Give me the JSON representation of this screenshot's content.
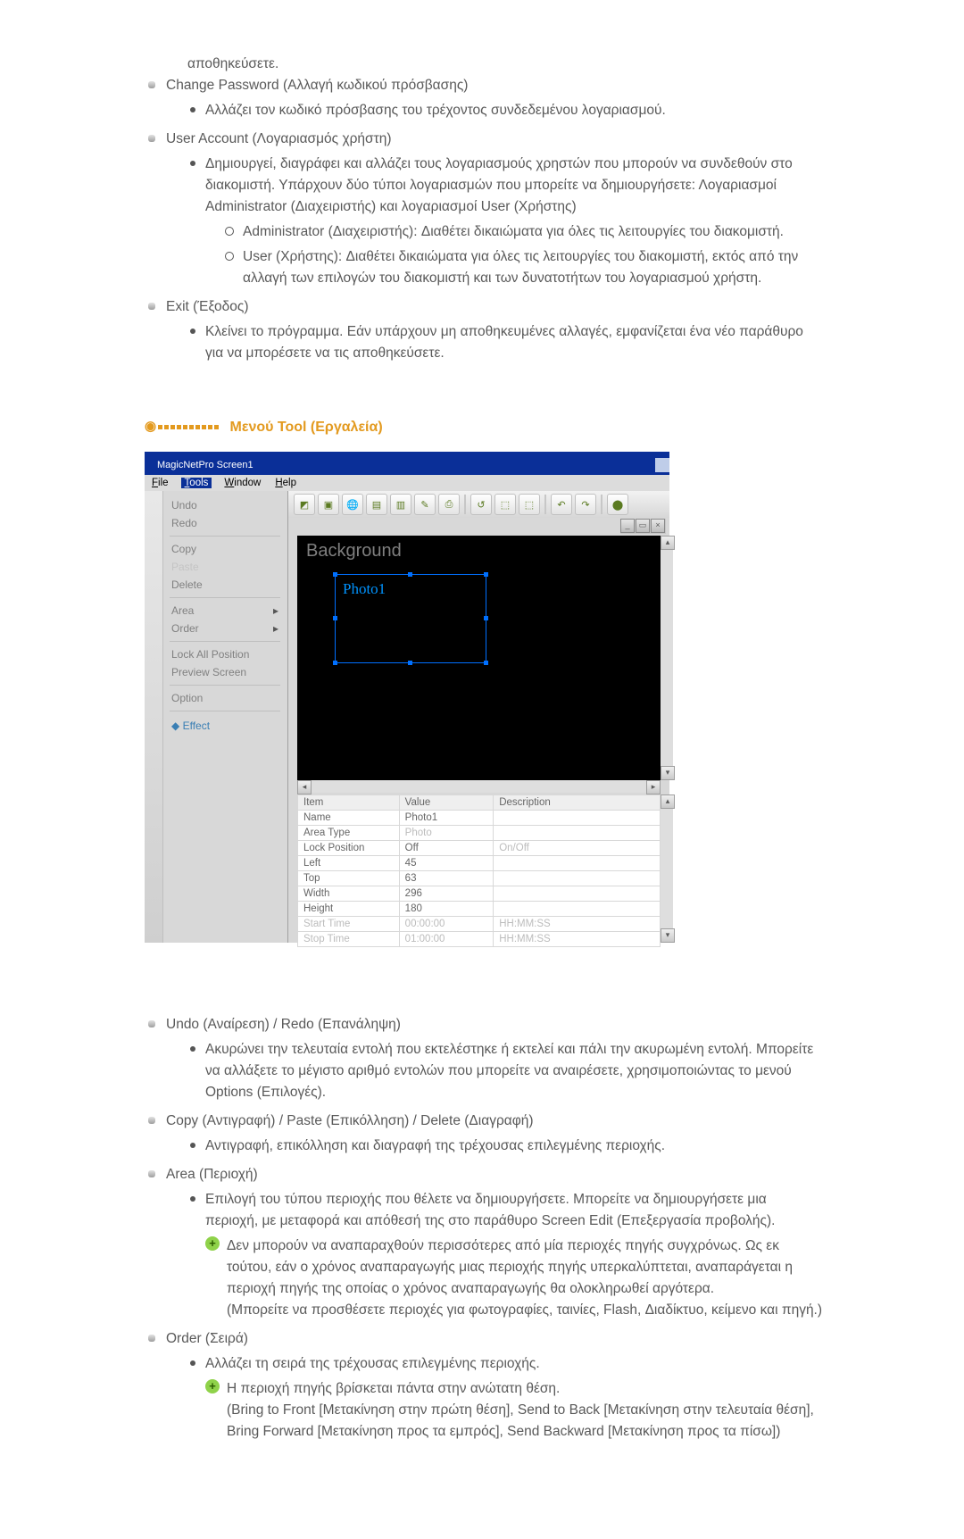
{
  "top_items": [
    {
      "pre": "αποθηκεύσετε."
    },
    {
      "title": "Change Password (Αλλαγή κωδικού πρόσβασης)",
      "bullets": [
        "Αλλάζει τον κωδικό πρόσβασης του τρέχοντος συνδεδεμένου λογαριασμού."
      ]
    },
    {
      "title": "User Account (Λογαριασμός χρήστη)",
      "bullets": [
        "Δημιουργεί, διαγράφει και αλλάζει τους λογαριασμούς χρηστών που μπορούν να συνδεθούν στο διακομιστή. Υπάρχουν δύο τύποι λογαριασμών που μπορείτε να δημιουργήσετε: Λογαριασμοί Administrator (Διαχειριστής) και λογαριασμοί User (Χρήστης)"
      ],
      "circles": [
        "Administrator (Διαχειριστής): Διαθέτει δικαιώματα για όλες τις λειτουργίες του διακομιστή.",
        "User (Χρήστης): Διαθέτει δικαιώματα για όλες τις λειτουργίες του διακομιστή, εκτός από την αλλαγή των επιλογών του διακομιστή και των δυνατοτήτων του λογαριασμού χρήστη."
      ]
    },
    {
      "title": "Exit (Έξοδος)",
      "bullets": [
        "Κλείνει το πρόγραμμα. Εάν υπάρχουν μη αποθηκευμένες αλλαγές, εμφανίζεται ένα νέο παράθυρο για να μπορέσετε να τις αποθηκεύσετε."
      ]
    }
  ],
  "section_title": "Μενού Tool (Εργαλεία)",
  "shot": {
    "title": "MagicNetPro Screen1",
    "menus": [
      "File",
      "Tools",
      "Window",
      "Help"
    ],
    "side": [
      "Undo",
      "Redo",
      "",
      "Copy",
      "Paste",
      "Delete",
      "",
      "Area",
      "Order",
      "",
      "Lock All Position",
      "Preview Screen",
      "",
      "Option",
      "",
      "Effect"
    ],
    "bg_label": "Background",
    "photo_label": "Photo1",
    "grid_head": [
      "Item",
      "Value",
      "Description"
    ],
    "grid_rows": [
      [
        "Name",
        "Photo1",
        ""
      ],
      [
        "Area Type",
        "Photo",
        ""
      ],
      [
        "Lock Position",
        "Off",
        "On/Off"
      ],
      [
        "Left",
        "45",
        ""
      ],
      [
        "Top",
        "63",
        ""
      ],
      [
        "Width",
        "296",
        ""
      ],
      [
        "Height",
        "180",
        ""
      ],
      [
        "Start Time",
        "00:00:00",
        "HH:MM:SS"
      ],
      [
        "Stop Time",
        "01:00:00",
        "HH:MM:SS"
      ]
    ]
  },
  "bottom_items": [
    {
      "title": "Undo (Αναίρεση) / Redo (Επανάληψη)",
      "bullets": [
        "Ακυρώνει την τελευταία εντολή που εκτελέστηκε ή εκτελεί και πάλι την ακυρωμένη εντολή. Μπορείτε να αλλάξετε το μέγιστο αριθμό εντολών που μπορείτε να αναιρέσετε, χρησιμοποιώντας το μενού Options (Επιλογές)."
      ]
    },
    {
      "title": "Copy (Αντιγραφή) / Paste (Επικόλληση) / Delete (Διαγραφή)",
      "bullets": [
        "Αντιγραφή, επικόλληση και διαγραφή της τρέχουσας επιλεγμένης περιοχής."
      ]
    },
    {
      "title": "Area (Περιοχή)",
      "bullets": [
        "Επιλογή του τύπου περιοχής που θέλετε να δημιουργήσετε. Μπορείτε να δημιουργήσετε μια περιοχή, με μεταφορά και απόθεσή της στο παράθυρο Screen Edit (Επεξεργασία προβολής)."
      ],
      "plus": [
        "Δεν μπορούν να αναπαραχθούν περισσότερες από μία περιοχές πηγής συγχρόνως. Ως εκ τούτου, εάν ο χρόνος αναπαραγωγής μιας περιοχής πηγής υπερκαλύπτεται, αναπαράγεται η περιοχή πηγής της οποίας ο χρόνος αναπαραγωγής θα ολοκληρωθεί αργότερα.\n(Μπορείτε να προσθέσετε περιοχές για φωτογραφίες, ταινίες, Flash, Διαδίκτυο, κείμενο και πηγή.)"
      ]
    },
    {
      "title": "Order (Σειρά)",
      "bullets": [
        "Αλλάζει τη σειρά της τρέχουσας επιλεγμένης περιοχής."
      ],
      "plus": [
        "Η περιοχή πηγής βρίσκεται πάντα στην ανώτατη θέση.\n(Bring to Front [Μετακίνηση στην πρώτη θέση], Send to Back [Μετακίνηση στην τελευταία θέση], Bring Forward [Μετακίνηση προς τα εμπρός], Send Backward [Μετακίνηση προς τα πίσω])"
      ]
    }
  ]
}
